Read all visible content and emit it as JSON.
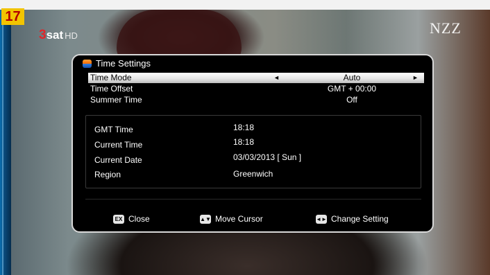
{
  "channel_badge": "17",
  "broadcaster_logo": {
    "number": "3",
    "name": "sat",
    "suffix": "HD"
  },
  "corner_logo": "NZZ",
  "dialog": {
    "title": "Time Settings",
    "settings": [
      {
        "label": "Time Mode",
        "value": "Auto"
      },
      {
        "label": "Time Offset",
        "value": "GMT + 00:00"
      },
      {
        "label": "Summer Time",
        "value": "Off"
      }
    ],
    "info": [
      {
        "label": "GMT Time",
        "value": "18:18"
      },
      {
        "label": "Current Time",
        "value": "18:18"
      },
      {
        "label": "Current Date",
        "value": "03/03/2013 [ Sun ]"
      },
      {
        "label": "Region",
        "value": "Greenwich"
      }
    ],
    "footer": {
      "close_key": "EX",
      "close_label": "Close",
      "move_label": "Move Cursor",
      "change_label": "Change Setting"
    }
  },
  "colors": {
    "badge": "#f2c400",
    "badge_text": "#b30000",
    "selection": "#e4e4e4",
    "osd_border": "#d9d9d9"
  }
}
